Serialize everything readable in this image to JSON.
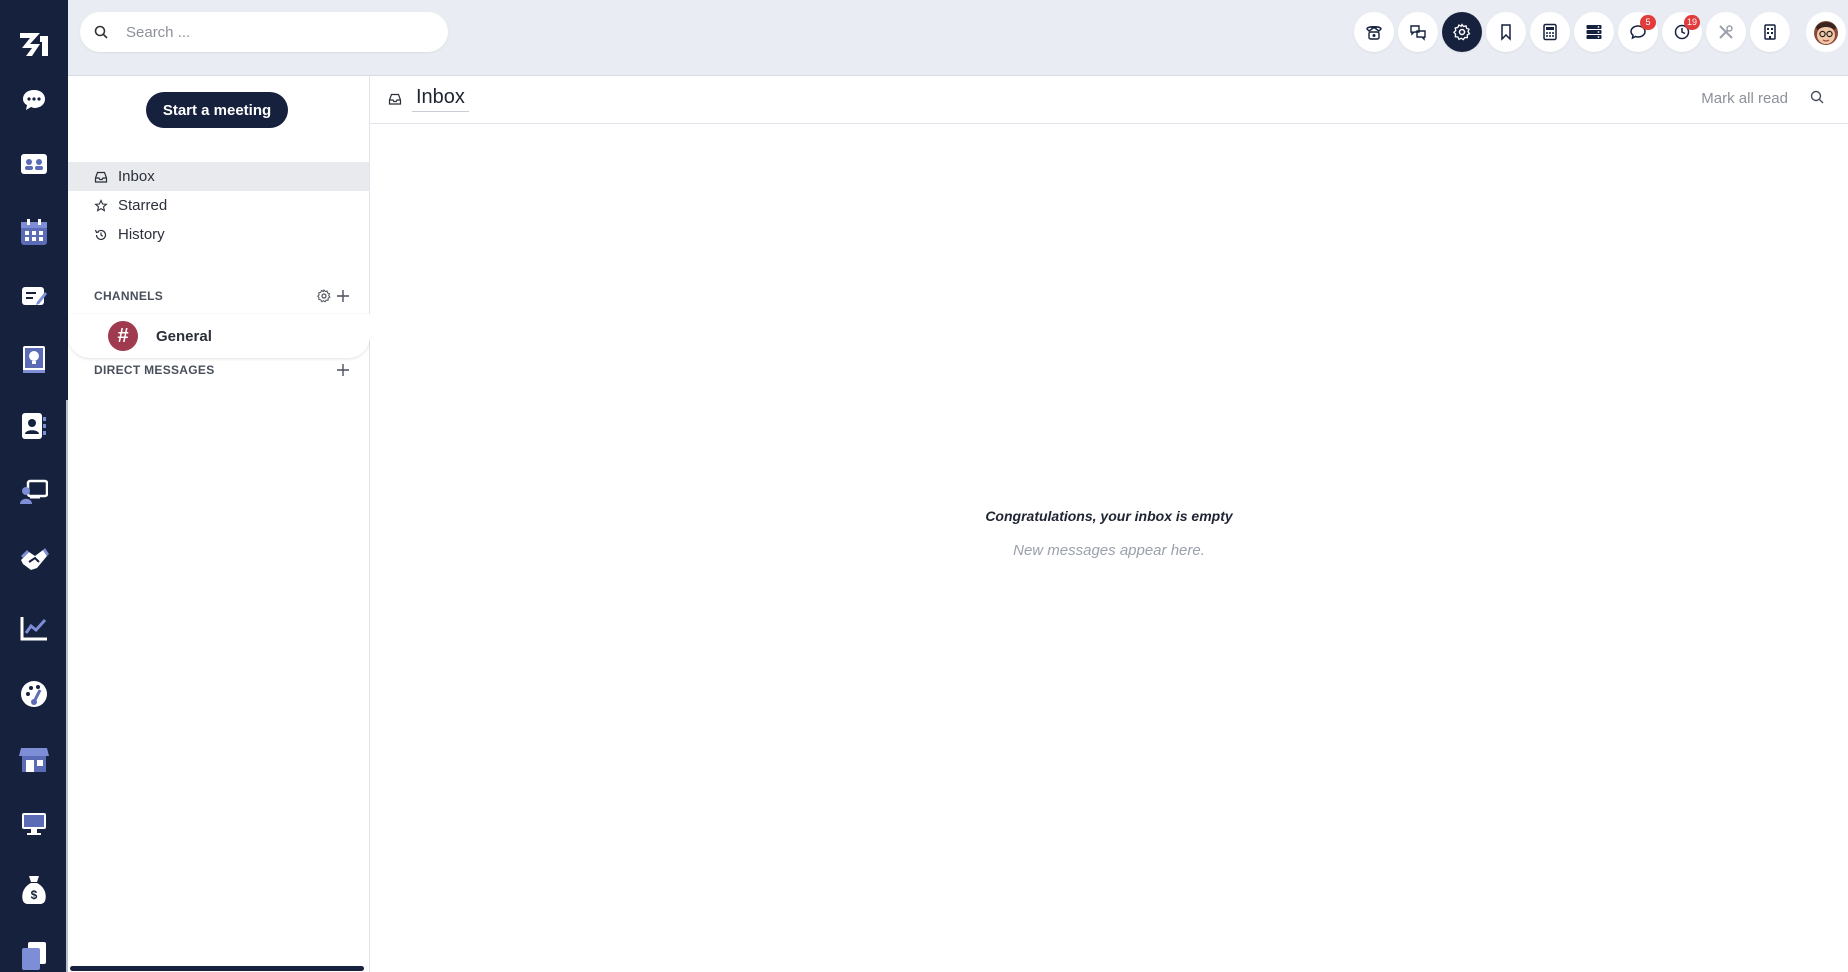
{
  "search": {
    "placeholder": "Search ..."
  },
  "topbar": {
    "buttons": [
      {
        "icon": "phone-icon"
      },
      {
        "icon": "discuss-icon"
      },
      {
        "icon": "gear-icon",
        "active": true
      },
      {
        "icon": "bookmark-icon"
      },
      {
        "icon": "calculator-icon"
      },
      {
        "icon": "server-icon"
      },
      {
        "icon": "chat-icon",
        "badge": "5"
      },
      {
        "icon": "clock-icon",
        "badge": "19"
      },
      {
        "icon": "tools-icon"
      },
      {
        "icon": "building-icon"
      }
    ],
    "avatar": "user-avatar"
  },
  "rail": {
    "items": [
      "chat-icon",
      "meeting-icon",
      "calendar-icon",
      "notes-icon",
      "knowledge-icon",
      "contacts-icon",
      "presentation-icon",
      "handshake-icon",
      "chart-icon",
      "dashboard-icon",
      "store-icon",
      "monitor-icon",
      "money-bag-icon",
      "documents-icon"
    ]
  },
  "sidebar": {
    "meeting_button": "Start a meeting",
    "nav": [
      {
        "label": "Inbox",
        "icon": "inbox-icon",
        "selected": true
      },
      {
        "label": "Starred",
        "icon": "star-icon"
      },
      {
        "label": "History",
        "icon": "history-icon"
      }
    ],
    "channels_title": "CHANNELS",
    "channels": [
      {
        "name": "General",
        "symbol": "#"
      }
    ],
    "dm_title": "DIRECT MESSAGES"
  },
  "main": {
    "title": "Inbox",
    "mark_all_read": "Mark all read",
    "empty_title": "Congratulations, your inbox is empty",
    "empty_subtitle": "New messages appear here."
  },
  "colors": {
    "rail": "#16213e",
    "topbar": "#e9ecf3",
    "accent": "#16213e",
    "channel_avatar": "#a03a4e",
    "badge": "#e23b3b"
  }
}
